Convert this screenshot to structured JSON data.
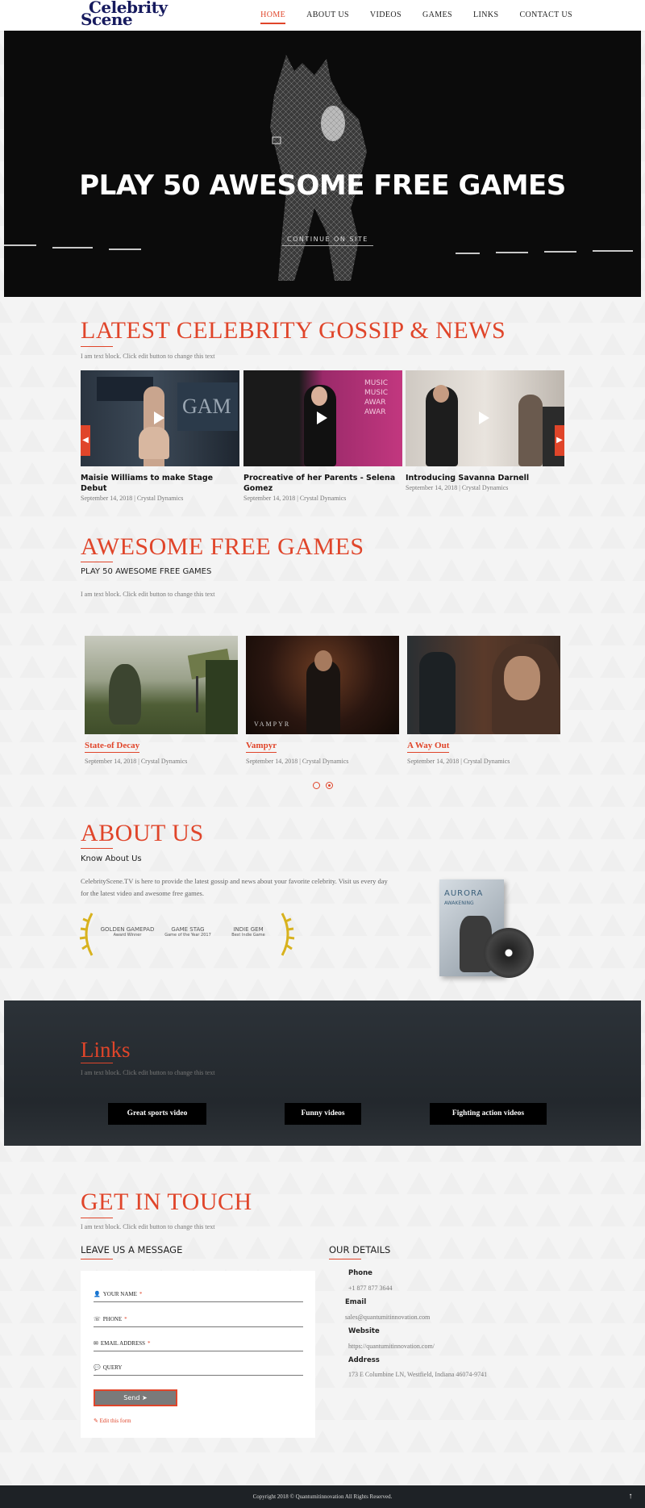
{
  "header": {
    "logo_line1": "Celebrity",
    "logo_line2": "Scene",
    "nav": [
      "HOME",
      "ABOUT US",
      "VIDEOS",
      "GAMES",
      "LINKS",
      "CONTACT US"
    ]
  },
  "hero": {
    "title": "PLAY 50 AWESOME FREE GAMES",
    "button": "CONTINUE ON SITE"
  },
  "gossip": {
    "title": "LATEST CELEBRITY GOSSIP & NEWS",
    "text": "I am text block. Click edit button to change this text",
    "cards": [
      {
        "title": "Maisie Williams to make Stage Debut",
        "meta": "September 14, 2018 | Crystal Dynamics"
      },
      {
        "title": "Procreative of her Parents - Selena Gomez",
        "meta": "September 14, 2018 | Crystal Dynamics"
      },
      {
        "title": "Introducing Savanna Darnell",
        "meta": "September 14, 2018 | Crystal Dynamics"
      }
    ]
  },
  "games": {
    "title": "AWESOME FREE GAMES",
    "subtitle": "PLAY 50 AWESOME FREE GAMES",
    "text": "I am text block. Click edit button to change this text",
    "items": [
      {
        "title": "State-of Decay",
        "meta": "September 14, 2018 | Crystal Dynamics"
      },
      {
        "title": "Vampyr",
        "meta": "September 14, 2018 | Crystal Dynamics",
        "caption": "VAMPYR"
      },
      {
        "title": "A Way Out",
        "meta": "September 14, 2018 | Crystal Dynamics"
      }
    ]
  },
  "about": {
    "title": "ABOUT US",
    "subtitle": "Know About Us",
    "text": "CelebrityScene.TV is here to provide the latest gossip and news about your favorite celebrity. Visit us every day for the latest video and awesome free games.",
    "awards": [
      {
        "name": "GOLDEN GAMEPAD",
        "sub": "Award Winner"
      },
      {
        "name": "GAME STAG",
        "sub": "Game of the Year 2017"
      },
      {
        "name": "INDIE GEM",
        "sub": "Best Indie Game"
      }
    ],
    "box_title": "AURORA",
    "box_subtitle": "AWAKENING"
  },
  "links": {
    "title": "Links",
    "text": "I am text block. Click edit button to change this text",
    "buttons": [
      "Great sports video",
      "Funny videos",
      "Fighting action videos"
    ]
  },
  "contact": {
    "title": "GET IN TOUCH",
    "text": "I am text block. Click edit button to change this text",
    "form_title": "LEAVE US A MESSAGE",
    "fields": {
      "name": "YOUR NAME",
      "phone": "PHONE",
      "email": "EMAIL ADDRESS",
      "query": "QUERY"
    },
    "required_mark": "*",
    "send": "Send",
    "edit_form": "Edit this form",
    "details_title": "OUR DETAILS",
    "details": {
      "phone_label": "Phone",
      "phone": "+1 877 877 3644",
      "email_label": "Email",
      "email": "sales@quantumitinnovation.com",
      "website_label": "Website",
      "website": "https://quantumitinnovation.com/",
      "address_label": "Address",
      "address": "173 E Columbine LN, Westfield, Indiana 46074-9741"
    }
  },
  "footer": {
    "copyright": "Copyright 2018 © Quantumitinnovation All Rights Reserved."
  },
  "colors": {
    "accent": "#e0452a",
    "dark": "#23282d",
    "logo": "#161a5e"
  }
}
